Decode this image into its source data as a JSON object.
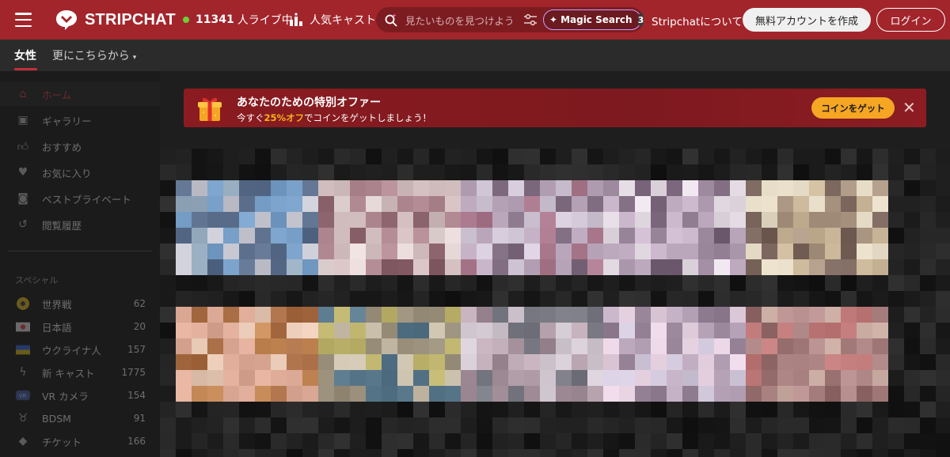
{
  "header": {
    "logo_text": "STRIPCHAT",
    "live_count": "11341",
    "live_label": "人ライブ中",
    "popular_label": "人気キャスト",
    "search_placeholder": "見たいものを見つけよう",
    "magic_search_label": "Magic Search",
    "magic_search_badge": "3",
    "about_label": "Stripchatについて",
    "create_account_label": "無料アカウントを作成",
    "login_label": "ログイン",
    "brand_color": "#a2252b",
    "live_dot_color": "#6fcf3a"
  },
  "subnav": {
    "tab_women": "女性",
    "tab_more": "更にこちらから"
  },
  "sidebar": {
    "items": [
      {
        "label": "ホーム",
        "icon": "home-icon"
      },
      {
        "label": "ギャラリー",
        "icon": "gallery-icon"
      },
      {
        "label": "おすすめ",
        "icon": "thumbs-up-icon"
      },
      {
        "label": "お気に入り",
        "icon": "heart-icon"
      },
      {
        "label": "ベストプライベート",
        "icon": "private-chat-icon"
      },
      {
        "label": "閲覧履歴",
        "icon": "history-icon"
      }
    ],
    "section_title": "スペシャル",
    "specials": [
      {
        "label": "世界戦",
        "count": "62",
        "icon": "ball-icon"
      },
      {
        "label": "日本語",
        "count": "20",
        "icon": "japan-flag-icon"
      },
      {
        "label": "ウクライナ人",
        "count": "157",
        "icon": "ukraine-flag-icon"
      },
      {
        "label": "新 キャスト",
        "count": "1775",
        "icon": "lightning-icon"
      },
      {
        "label": "VR カメラ",
        "count": "154",
        "icon": "vr-icon"
      },
      {
        "label": "BDSM",
        "count": "91",
        "icon": "bdsm-icon"
      },
      {
        "label": "チケット",
        "count": "166",
        "icon": "ticket-icon"
      }
    ]
  },
  "promo": {
    "title": "あなたのための特別オファー",
    "sub_prefix": "今すぐ",
    "sub_highlight": "25%オフ",
    "sub_suffix": "でコインをゲットしましょう！",
    "cta_label": "コインをゲット",
    "close_symbol": "✕",
    "accent_color": "#f5a623"
  }
}
